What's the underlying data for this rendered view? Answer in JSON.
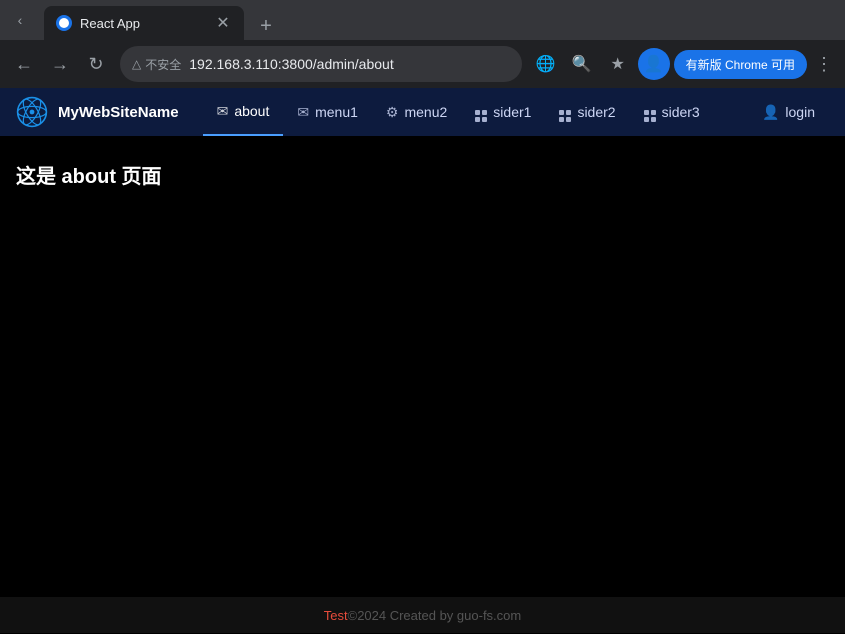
{
  "browser": {
    "tab_title": "React App",
    "tab_favicon": "react-favicon",
    "address": "192.168.3.110:3800/admin/about",
    "security_label": "不安全",
    "chrome_update_label": "有新版 Chrome 可用",
    "new_tab_label": "+",
    "back_disabled": false,
    "forward_disabled": false
  },
  "navbar": {
    "brand_name": "MyWebSiteName",
    "nav_items": [
      {
        "id": "about",
        "label": "about",
        "icon": "envelope",
        "active": true
      },
      {
        "id": "menu1",
        "label": "menu1",
        "icon": "envelope",
        "active": false
      },
      {
        "id": "menu2",
        "label": "menu2",
        "icon": "gear",
        "active": false
      },
      {
        "id": "sider1",
        "label": "sider1",
        "icon": "grid",
        "active": false
      },
      {
        "id": "sider2",
        "label": "sider2",
        "icon": "grid",
        "active": false
      },
      {
        "id": "sider3",
        "label": "sider3",
        "icon": "grid",
        "active": false
      }
    ],
    "login_label": "login"
  },
  "main": {
    "page_heading": "这是 about 页面"
  },
  "footer": {
    "highlight": "Test",
    "copy": "©2024 Created by guo-fs.com"
  }
}
